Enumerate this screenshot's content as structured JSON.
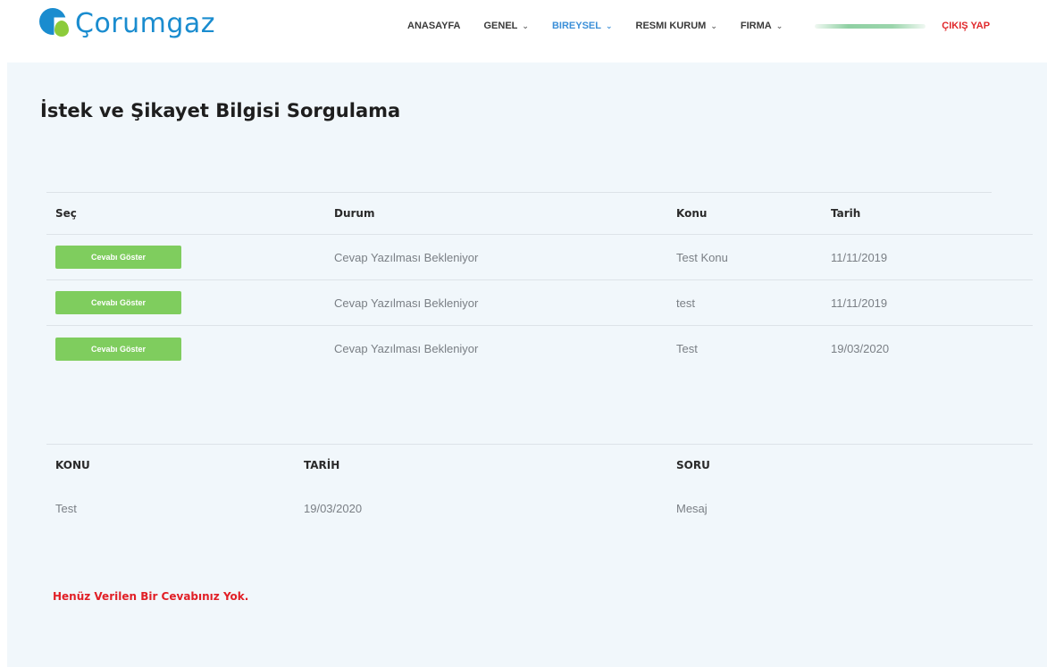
{
  "brand": {
    "name": "Çorumgaz"
  },
  "nav": {
    "items": [
      {
        "label": "ANASAYFA",
        "dropdown": false
      },
      {
        "label": "GENEL",
        "dropdown": true
      },
      {
        "label": "BIREYSEL",
        "dropdown": true,
        "active": true
      },
      {
        "label": "RESMI KURUM",
        "dropdown": true
      },
      {
        "label": "FIRMA",
        "dropdown": true
      }
    ],
    "chevron": "⌄",
    "logout_label": "ÇIKIŞ YAP"
  },
  "page": {
    "title": "İstek ve Şikayet Bilgisi Sorgulama"
  },
  "requests_table": {
    "headers": {
      "select": "Seç",
      "status": "Durum",
      "subject": "Konu",
      "date": "Tarih"
    },
    "rows": [
      {
        "button": "Cevabı Göster",
        "status": "Cevap Yazılması Bekleniyor",
        "subject": "Test Konu",
        "date": "11/11/2019"
      },
      {
        "button": "Cevabı Göster",
        "status": "Cevap Yazılması Bekleniyor",
        "subject": "test",
        "date": "11/11/2019"
      },
      {
        "button": "Cevabı Göster",
        "status": "Cevap Yazılması Bekleniyor",
        "subject": "Test",
        "date": "19/03/2020"
      }
    ]
  },
  "detail_table": {
    "headers": {
      "subject": "KONU",
      "date": "TARİH",
      "question": "SORU"
    },
    "row": {
      "subject": "Test",
      "date": "19/03/2020",
      "question": "Mesaj"
    }
  },
  "message": {
    "no_answer": "Henüz Verilen Bir Cevabınız Yok."
  },
  "colors": {
    "brand_blue": "#1a8ccf",
    "brand_green": "#8ccb3b",
    "button_green": "#7fcd5e",
    "active_nav": "#3b8fd8",
    "alert_red": "#e11f26",
    "panel_bg": "#f1f7fb"
  }
}
